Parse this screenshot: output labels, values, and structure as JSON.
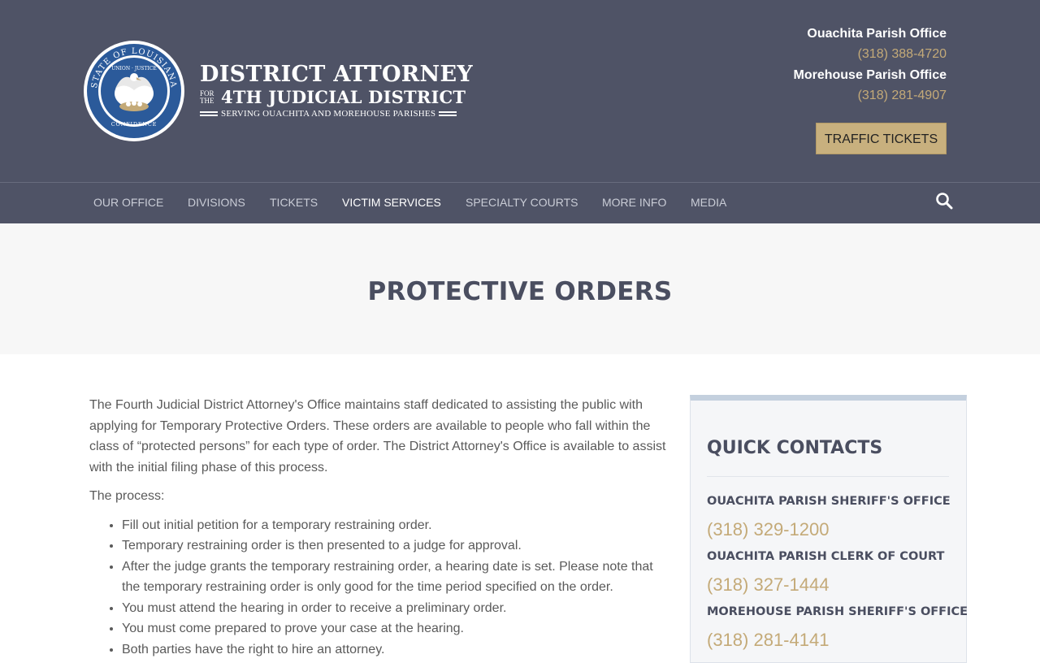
{
  "header": {
    "brand_line1": "DISTRICT ATTORNEY",
    "brand_for_the_1": "FOR",
    "brand_for_the_2": "THE",
    "brand_line2": "4TH JUDICIAL DISTRICT",
    "brand_tagline": "SERVING OUACHITA AND MOREHOUSE PARISHES",
    "seal_text_top": "STATE OF LOUISIANA",
    "seal_text_inner": "UNION · JUSTICE",
    "seal_text_bottom": "CONFIDENCE",
    "offices": [
      {
        "name": "Ouachita Parish Office",
        "phone": "(318) 388-4720"
      },
      {
        "name": "Morehouse Parish Office",
        "phone": "(318) 281-4907"
      }
    ],
    "traffic_button": "TRAFFIC TICKETS"
  },
  "nav": {
    "items": [
      {
        "label": "OUR OFFICE"
      },
      {
        "label": "DIVISIONS"
      },
      {
        "label": "TICKETS"
      },
      {
        "label": "VICTIM SERVICES",
        "active": true
      },
      {
        "label": "SPECIALTY COURTS"
      },
      {
        "label": "MORE INFO"
      },
      {
        "label": "MEDIA"
      }
    ],
    "search_icon": "search-icon"
  },
  "page": {
    "title": "PROTECTIVE ORDERS"
  },
  "content": {
    "intro": "The Fourth Judicial District Attorney's Office maintains staff dedicated to assisting the public with applying for Temporary Protective Orders.  These orders are available to people who fall within the class of “protected persons” for each type of order.  The District Attorney's Office is available to assist with the initial filing phase of this process.",
    "process_label": "The process:",
    "steps": [
      "Fill out initial petition for a temporary restraining order.",
      "Temporary restraining order is then presented to a judge for approval.",
      "After the judge grants the temporary restraining order, a hearing date is set. Please note that the temporary restraining order is only good for the time period specified on the order.",
      "You must attend the hearing in order to receive a preliminary order.",
      "You must come prepared to prove your case at the hearing.",
      "Both parties have the right to hire an attorney."
    ]
  },
  "sidebar": {
    "title": "QUICK CONTACTS",
    "contacts": [
      {
        "name": "OUACHITA PARISH SHERIFF'S OFFICE",
        "phone": "(318) 329-1200"
      },
      {
        "name": "OUACHITA PARISH CLERK OF COURT",
        "phone": "(318) 327-1444"
      },
      {
        "name": "MOREHOUSE PARISH SHERIFF'S OFFICE",
        "phone": "(318) 281-4141"
      }
    ]
  },
  "colors": {
    "header_bg": "#4f5366",
    "accent_gold": "#c4aa78",
    "button_gold": "#c8b07e",
    "title_text": "#4a4e60"
  }
}
